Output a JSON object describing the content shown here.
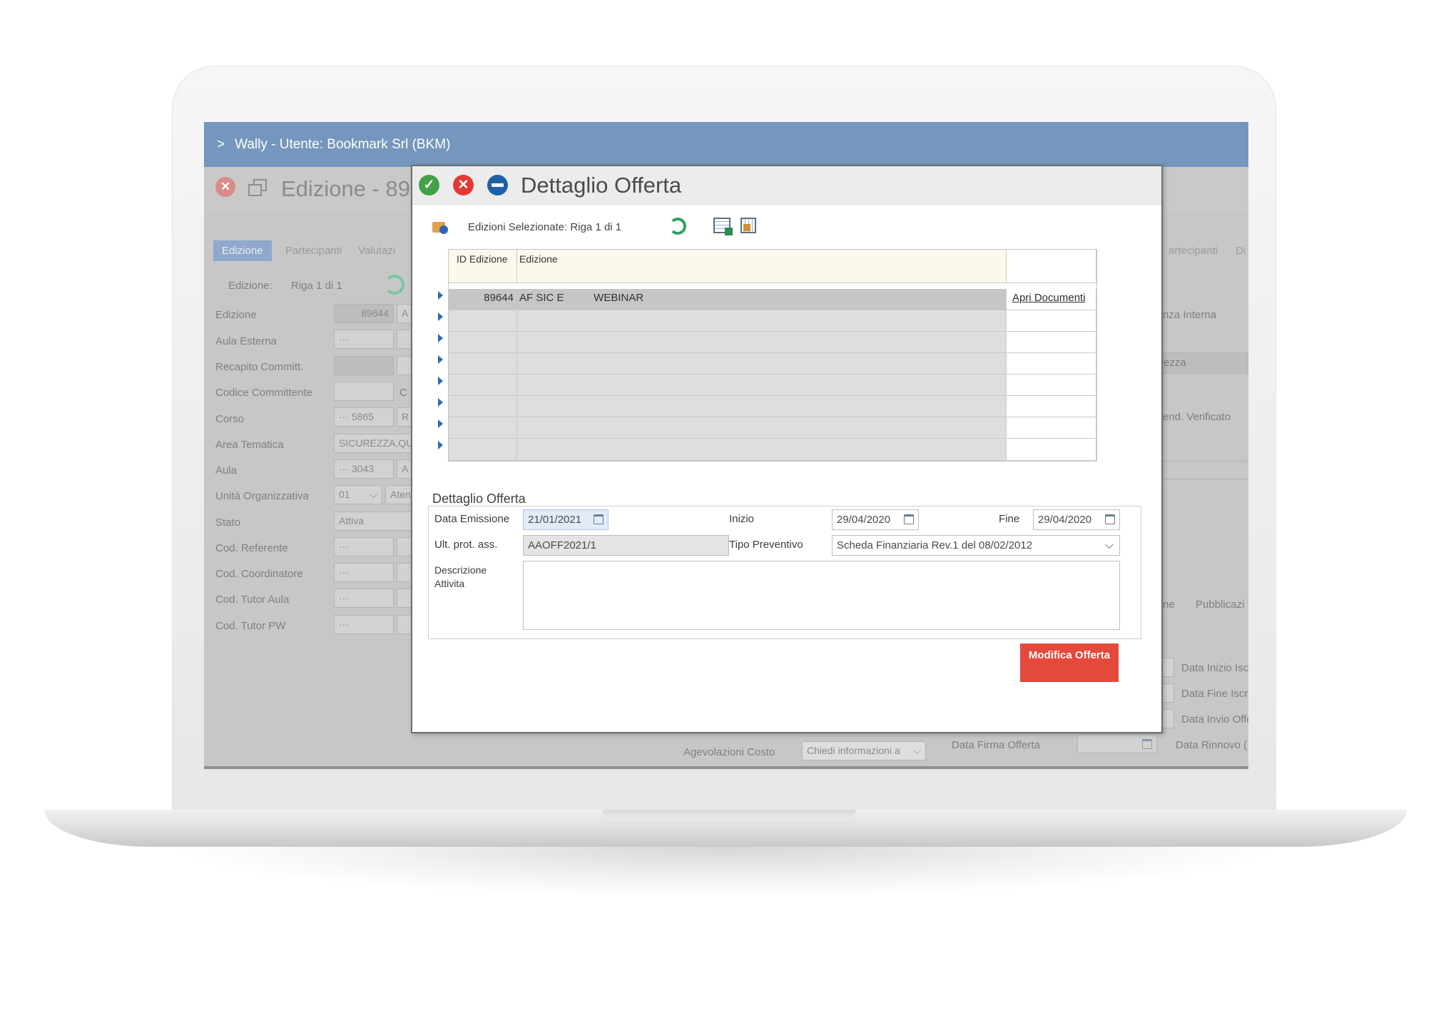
{
  "app": {
    "window_title": "Wally - Utente: Bookmark Srl (BKM)"
  },
  "background_window": {
    "title": "Edizione - 89",
    "tabs": [
      "Edizione",
      "Partecipanti",
      "Valutazi"
    ],
    "right_tabs": [
      "artecipanti",
      "Di"
    ],
    "record_label": "Edizione:",
    "record_position": "Riga 1 di 1",
    "fields": [
      {
        "label": "Edizione",
        "value": "89644",
        "suffix": "A"
      },
      {
        "label": "Aula Esterna",
        "value": "···",
        "suffix": ""
      },
      {
        "label": "Recapito Committ.",
        "value": "",
        "suffix": ""
      },
      {
        "label": "Codice Committente",
        "value": "",
        "suffix": "C"
      },
      {
        "label": "Corso",
        "value": "···   5865",
        "suffix": "R"
      },
      {
        "label": "Area Tematica",
        "value": "SICUREZZA,QU",
        "suffix": ""
      },
      {
        "label": "Aula",
        "value": "···   3043",
        "suffix": "A"
      },
      {
        "label": "Unità Organizzativa",
        "value": "01",
        "suffix": "Aten"
      },
      {
        "label": "Stato",
        "value": "Attiva",
        "suffix": ""
      },
      {
        "label": "Cod. Referente",
        "value": "···",
        "suffix": ""
      },
      {
        "label": "Cod. Coordinatore",
        "value": "···",
        "suffix": ""
      },
      {
        "label": "Cod. Tutor Aula",
        "value": "···",
        "suffix": ""
      },
      {
        "label": "Cod. Tutor PW",
        "value": "···",
        "suffix": ""
      }
    ],
    "right_labels": {
      "r1": "nza Interna",
      "r2": "ezza",
      "r3": "end. Verificato",
      "r4_tab1": "ne",
      "r4_tab2": "Pubblicazi",
      "d1": "Data Inizio Isc",
      "d2": "Data Fine Iscri",
      "d3": "Data Invio Offe",
      "d4": "Data Rinnovo (",
      "firma": "Data Firma Offerta"
    },
    "agevolazioni_label": "Agevolazioni Costo",
    "agevolazioni_value": "Chiedi informazioni a"
  },
  "dialog": {
    "title": "Dettaglio Offerta",
    "toolbar": {
      "selection_text": "Edizioni Selezionate: Riga 1 di 1"
    },
    "grid": {
      "columns": [
        "ID Edizione",
        "Edizione",
        ""
      ],
      "rows": [
        {
          "id": "89644",
          "edizione": "AF SIC E          WEBINAR",
          "link": "Apri Documenti"
        },
        {
          "id": "",
          "edizione": "",
          "link": ""
        },
        {
          "id": "",
          "edizione": "",
          "link": ""
        },
        {
          "id": "",
          "edizione": "",
          "link": ""
        },
        {
          "id": "",
          "edizione": "",
          "link": ""
        },
        {
          "id": "",
          "edizione": "",
          "link": ""
        },
        {
          "id": "",
          "edizione": "",
          "link": ""
        },
        {
          "id": "",
          "edizione": "",
          "link": ""
        }
      ]
    },
    "detail": {
      "section_title": "Dettaglio Offerta",
      "data_emissione_label": "Data Emissione",
      "data_emissione": "21/01/2021",
      "inizio_label": "Inizio",
      "inizio": "29/04/2020",
      "fine_label": "Fine",
      "fine": "29/04/2020",
      "ult_prot_label": "Ult. prot. ass.",
      "ult_prot": "AAOFF2021/1",
      "tipo_preventivo_label": "Tipo Preventivo",
      "tipo_preventivo": "Scheda Finanziaria Rev.1 del 08/02/2012",
      "descrizione_label_1": "Descrizione",
      "descrizione_label_2": "Attivita",
      "descrizione": ""
    },
    "button_modifica": "Modifica Offerta"
  },
  "colors": {
    "titlebar": "#7597bd",
    "accept": "#43a047",
    "cancel": "#e53935",
    "minus": "#1e5fa8",
    "modifica_button": "#e5493c"
  }
}
